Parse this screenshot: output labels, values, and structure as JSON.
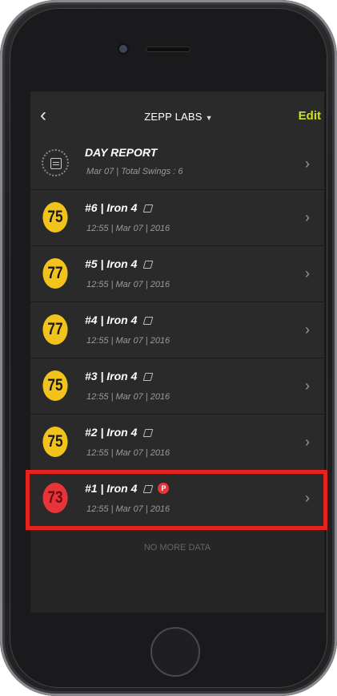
{
  "header": {
    "title": "ZEPP LABS",
    "edit_label": "Edit",
    "back_icon": "chevron-left-icon"
  },
  "day_report": {
    "title": "DAY REPORT",
    "subtitle": "Mar 07 | Total Swings : 6"
  },
  "swings": [
    {
      "score": "75",
      "title": "#6 | Iron 4",
      "subtitle": "12:55 | Mar 07 | 2016",
      "color": "#f2c31a"
    },
    {
      "score": "77",
      "title": "#5 | Iron 4",
      "subtitle": "12:55 | Mar 07 | 2016",
      "color": "#f2c31a"
    },
    {
      "score": "77",
      "title": "#4 | Iron 4",
      "subtitle": "12:55 | Mar 07 | 2016",
      "color": "#f2c31a"
    },
    {
      "score": "75",
      "title": "#3 | Iron 4",
      "subtitle": "12:55 | Mar 07 | 2016",
      "color": "#f2c31a"
    },
    {
      "score": "75",
      "title": "#2 | Iron 4",
      "subtitle": "12:55 | Mar 07 | 2016",
      "color": "#f2c31a"
    },
    {
      "score": "73",
      "title": "#1 | Iron 4",
      "subtitle": "12:55 | Mar 07 | 2016",
      "color": "#e8333a",
      "badge_p": "P"
    }
  ],
  "footer": {
    "no_more": "NO MORE DATA"
  },
  "colors": {
    "accent": "#cde21f",
    "highlight": "#e5231b"
  }
}
